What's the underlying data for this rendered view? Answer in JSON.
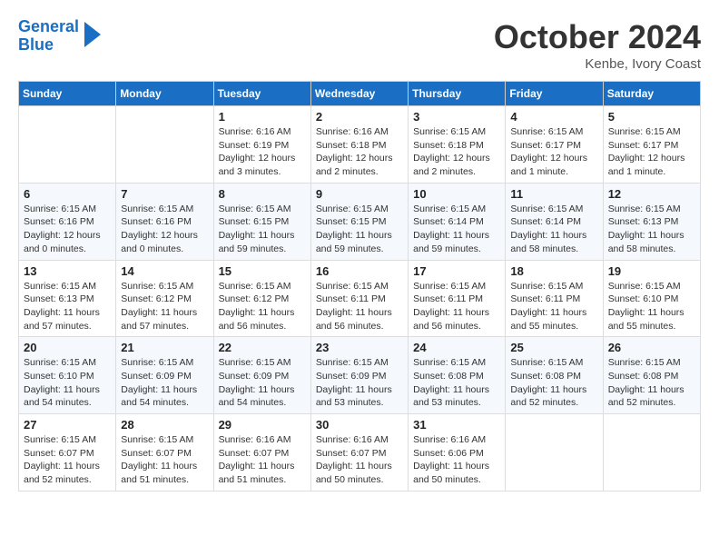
{
  "header": {
    "logo_line1": "General",
    "logo_line2": "Blue",
    "month_title": "October 2024",
    "subtitle": "Kenbe, Ivory Coast"
  },
  "weekdays": [
    "Sunday",
    "Monday",
    "Tuesday",
    "Wednesday",
    "Thursday",
    "Friday",
    "Saturday"
  ],
  "weeks": [
    [
      {
        "day": "",
        "info": ""
      },
      {
        "day": "",
        "info": ""
      },
      {
        "day": "1",
        "info": "Sunrise: 6:16 AM\nSunset: 6:19 PM\nDaylight: 12 hours\nand 3 minutes."
      },
      {
        "day": "2",
        "info": "Sunrise: 6:16 AM\nSunset: 6:18 PM\nDaylight: 12 hours\nand 2 minutes."
      },
      {
        "day": "3",
        "info": "Sunrise: 6:15 AM\nSunset: 6:18 PM\nDaylight: 12 hours\nand 2 minutes."
      },
      {
        "day": "4",
        "info": "Sunrise: 6:15 AM\nSunset: 6:17 PM\nDaylight: 12 hours\nand 1 minute."
      },
      {
        "day": "5",
        "info": "Sunrise: 6:15 AM\nSunset: 6:17 PM\nDaylight: 12 hours\nand 1 minute."
      }
    ],
    [
      {
        "day": "6",
        "info": "Sunrise: 6:15 AM\nSunset: 6:16 PM\nDaylight: 12 hours\nand 0 minutes."
      },
      {
        "day": "7",
        "info": "Sunrise: 6:15 AM\nSunset: 6:16 PM\nDaylight: 12 hours\nand 0 minutes."
      },
      {
        "day": "8",
        "info": "Sunrise: 6:15 AM\nSunset: 6:15 PM\nDaylight: 11 hours\nand 59 minutes."
      },
      {
        "day": "9",
        "info": "Sunrise: 6:15 AM\nSunset: 6:15 PM\nDaylight: 11 hours\nand 59 minutes."
      },
      {
        "day": "10",
        "info": "Sunrise: 6:15 AM\nSunset: 6:14 PM\nDaylight: 11 hours\nand 59 minutes."
      },
      {
        "day": "11",
        "info": "Sunrise: 6:15 AM\nSunset: 6:14 PM\nDaylight: 11 hours\nand 58 minutes."
      },
      {
        "day": "12",
        "info": "Sunrise: 6:15 AM\nSunset: 6:13 PM\nDaylight: 11 hours\nand 58 minutes."
      }
    ],
    [
      {
        "day": "13",
        "info": "Sunrise: 6:15 AM\nSunset: 6:13 PM\nDaylight: 11 hours\nand 57 minutes."
      },
      {
        "day": "14",
        "info": "Sunrise: 6:15 AM\nSunset: 6:12 PM\nDaylight: 11 hours\nand 57 minutes."
      },
      {
        "day": "15",
        "info": "Sunrise: 6:15 AM\nSunset: 6:12 PM\nDaylight: 11 hours\nand 56 minutes."
      },
      {
        "day": "16",
        "info": "Sunrise: 6:15 AM\nSunset: 6:11 PM\nDaylight: 11 hours\nand 56 minutes."
      },
      {
        "day": "17",
        "info": "Sunrise: 6:15 AM\nSunset: 6:11 PM\nDaylight: 11 hours\nand 56 minutes."
      },
      {
        "day": "18",
        "info": "Sunrise: 6:15 AM\nSunset: 6:11 PM\nDaylight: 11 hours\nand 55 minutes."
      },
      {
        "day": "19",
        "info": "Sunrise: 6:15 AM\nSunset: 6:10 PM\nDaylight: 11 hours\nand 55 minutes."
      }
    ],
    [
      {
        "day": "20",
        "info": "Sunrise: 6:15 AM\nSunset: 6:10 PM\nDaylight: 11 hours\nand 54 minutes."
      },
      {
        "day": "21",
        "info": "Sunrise: 6:15 AM\nSunset: 6:09 PM\nDaylight: 11 hours\nand 54 minutes."
      },
      {
        "day": "22",
        "info": "Sunrise: 6:15 AM\nSunset: 6:09 PM\nDaylight: 11 hours\nand 54 minutes."
      },
      {
        "day": "23",
        "info": "Sunrise: 6:15 AM\nSunset: 6:09 PM\nDaylight: 11 hours\nand 53 minutes."
      },
      {
        "day": "24",
        "info": "Sunrise: 6:15 AM\nSunset: 6:08 PM\nDaylight: 11 hours\nand 53 minutes."
      },
      {
        "day": "25",
        "info": "Sunrise: 6:15 AM\nSunset: 6:08 PM\nDaylight: 11 hours\nand 52 minutes."
      },
      {
        "day": "26",
        "info": "Sunrise: 6:15 AM\nSunset: 6:08 PM\nDaylight: 11 hours\nand 52 minutes."
      }
    ],
    [
      {
        "day": "27",
        "info": "Sunrise: 6:15 AM\nSunset: 6:07 PM\nDaylight: 11 hours\nand 52 minutes."
      },
      {
        "day": "28",
        "info": "Sunrise: 6:15 AM\nSunset: 6:07 PM\nDaylight: 11 hours\nand 51 minutes."
      },
      {
        "day": "29",
        "info": "Sunrise: 6:16 AM\nSunset: 6:07 PM\nDaylight: 11 hours\nand 51 minutes."
      },
      {
        "day": "30",
        "info": "Sunrise: 6:16 AM\nSunset: 6:07 PM\nDaylight: 11 hours\nand 50 minutes."
      },
      {
        "day": "31",
        "info": "Sunrise: 6:16 AM\nSunset: 6:06 PM\nDaylight: 11 hours\nand 50 minutes."
      },
      {
        "day": "",
        "info": ""
      },
      {
        "day": "",
        "info": ""
      }
    ]
  ]
}
